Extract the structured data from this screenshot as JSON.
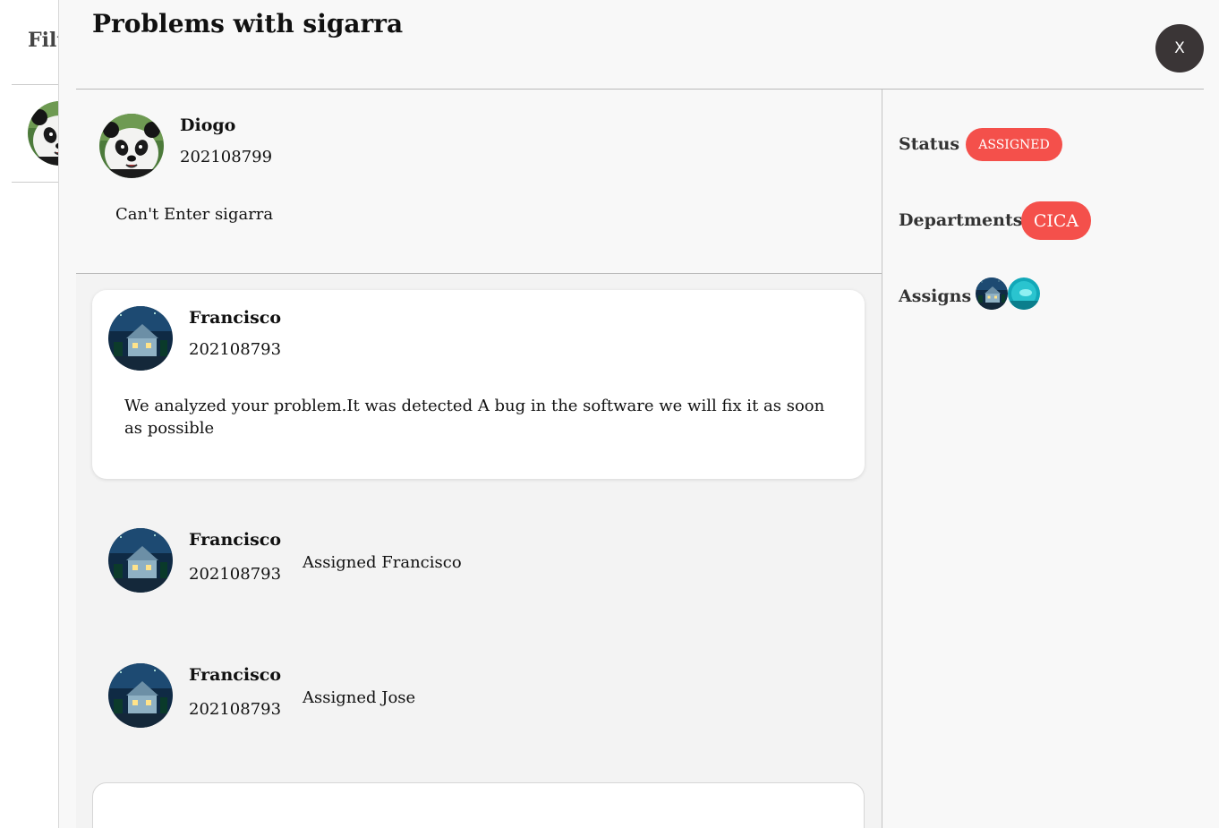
{
  "background": {
    "filter_label": "Filt"
  },
  "modal": {
    "title": "Problems with sigarra",
    "close_label": "X"
  },
  "ticket": {
    "author_name": "Diogo",
    "author_id": "202108799",
    "description": "Can't Enter sigarra"
  },
  "thread": {
    "comment": {
      "author_name": "Francisco",
      "author_id": "202108793",
      "text": "We analyzed your problem.It was detected A bug in the software we will fix it as soon as possible"
    },
    "events": [
      {
        "author_name": "Francisco",
        "author_id": "202108793",
        "action": "Assigned Francisco"
      },
      {
        "author_name": "Francisco",
        "author_id": "202108793",
        "action": "Assigned Jose"
      }
    ]
  },
  "sidebar": {
    "status_label": "Status",
    "status_value": "ASSIGNED",
    "departments_label": "Departments",
    "department_value": "CICA",
    "assigns_label": "Assigns"
  },
  "colors": {
    "accent": "#f4504b",
    "close_button": "#3a3536"
  },
  "icons": {
    "close": "x-glyph",
    "user_avatar": "panda-photo",
    "staff_avatar": "night-house-photo",
    "assignee_avatar": "teal-water-photo"
  }
}
